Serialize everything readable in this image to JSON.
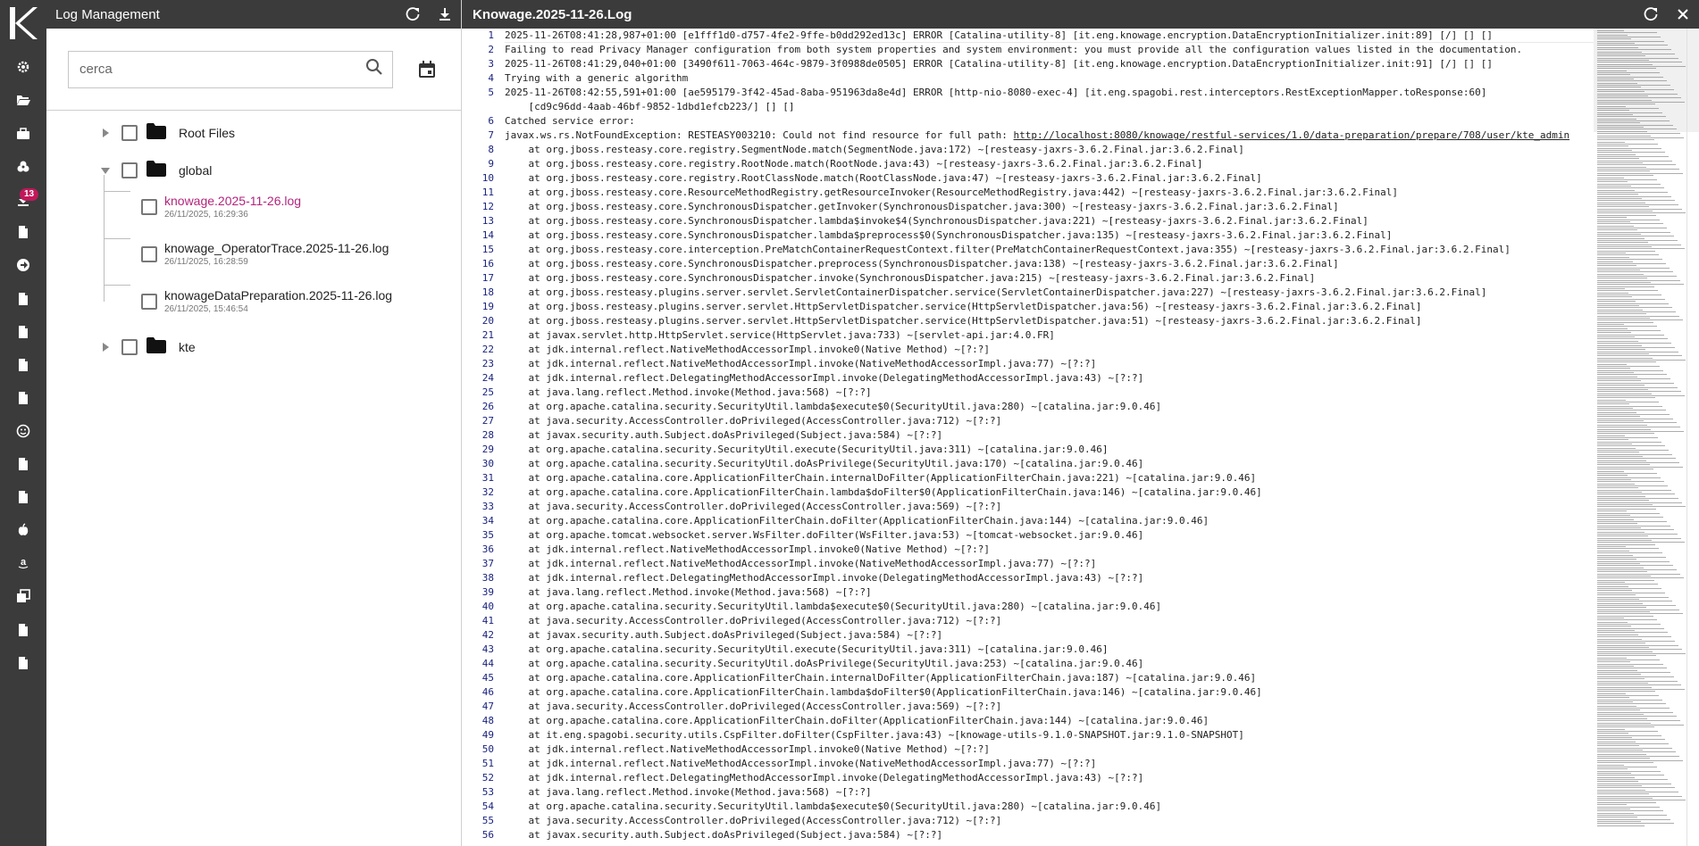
{
  "colors": {
    "rail_bg": "#3b3b3b",
    "active_file": "#b3247d",
    "badge": "#c2185b",
    "line_number": "#1a237e"
  },
  "rail": {
    "badge_count": "13",
    "items": [
      {
        "icon": "gear-icon"
      },
      {
        "icon": "folder-open-icon"
      },
      {
        "icon": "briefcase-icon"
      },
      {
        "icon": "cogs-icon"
      },
      {
        "icon": "download-icon"
      },
      {
        "icon": "document-icon"
      },
      {
        "icon": "arrow-circle-right-icon"
      },
      {
        "icon": "document-icon"
      },
      {
        "icon": "document-icon"
      },
      {
        "icon": "document-icon"
      },
      {
        "icon": "document-icon"
      },
      {
        "icon": "smile-icon"
      },
      {
        "icon": "document-icon"
      },
      {
        "icon": "document-icon"
      },
      {
        "icon": "apple-icon"
      },
      {
        "icon": "amazon-icon"
      },
      {
        "icon": "clone-icon"
      },
      {
        "icon": "document-icon"
      },
      {
        "icon": "document-icon"
      }
    ]
  },
  "panel": {
    "title": "Log Management",
    "refresh_icon": "refresh-icon",
    "download_icon": "download-icon",
    "search": {
      "placeholder": "cerca",
      "value": ""
    },
    "tree": {
      "root_files": "Root Files",
      "global": "global",
      "files": [
        {
          "name": "knowage.2025-11-26.log",
          "date": "26/11/2025, 16:29:36"
        },
        {
          "name": "knowage_OperatorTrace.2025-11-26.log",
          "date": "26/11/2025, 16:28:59"
        },
        {
          "name": "knowageDataPreparation.2025-11-26.log",
          "date": "26/11/2025, 15:46:54"
        }
      ],
      "kte": "kte"
    }
  },
  "viewer": {
    "title": "Knowage.2025-11-26.Log",
    "line_numbers": [
      "1",
      "2",
      "3",
      "4",
      "5",
      "",
      "6",
      "7",
      "8",
      "9",
      "10",
      "11",
      "12",
      "13",
      "14",
      "15",
      "16",
      "17",
      "18",
      "19",
      "20",
      "21",
      "22",
      "23",
      "24",
      "25",
      "26",
      "27",
      "28",
      "29",
      "30",
      "31",
      "32",
      "33",
      "34",
      "35",
      "36",
      "37",
      "38",
      "39",
      "40",
      "41",
      "42",
      "43",
      "44",
      "45",
      "46",
      "47",
      "48",
      "49",
      "50",
      "51",
      "52",
      "53",
      "54",
      "55",
      "56"
    ],
    "lines": [
      "2025-11-26T08:41:28,987+01:00 [e1fff1d0-d757-4fe2-9ffe-b0dd292ed13c] ERROR [Catalina-utility-8] [it.eng.knowage.encryption.DataEncryptionInitializer.init:89] [/] [] []",
      "Failing to read Privacy Manager configuration from both system properties and system environment: you must provide all the configuration values listed in the documentation.",
      "2025-11-26T08:41:29,040+01:00 [3490f611-7063-464c-9879-3f0988de0505] ERROR [Catalina-utility-8] [it.eng.knowage.encryption.DataEncryptionInitializer.init:91] [/] [] []",
      "Trying with a generic algorithm",
      "2025-11-26T08:42:55,591+01:00 [ae595179-3f42-45ad-8aba-951963da8e4d] ERROR [http-nio-8080-exec-4] [it.eng.spagobi.rest.interceptors.RestExceptionMapper.toResponse:60]",
      "    [cd9c96dd-4aab-46bf-9852-1dbd1efcb223/] [] []",
      "Catched service error:",
      "javax.ws.rs.NotFoundException: RESTEASY003210: Could not find resource for full path: ",
      "    at org.jboss.resteasy.core.registry.SegmentNode.match(SegmentNode.java:172) ~[resteasy-jaxrs-3.6.2.Final.jar:3.6.2.Final]",
      "    at org.jboss.resteasy.core.registry.RootNode.match(RootNode.java:43) ~[resteasy-jaxrs-3.6.2.Final.jar:3.6.2.Final]",
      "    at org.jboss.resteasy.core.registry.RootClassNode.match(RootClassNode.java:47) ~[resteasy-jaxrs-3.6.2.Final.jar:3.6.2.Final]",
      "    at org.jboss.resteasy.core.ResourceMethodRegistry.getResourceInvoker(ResourceMethodRegistry.java:442) ~[resteasy-jaxrs-3.6.2.Final.jar:3.6.2.Final]",
      "    at org.jboss.resteasy.core.SynchronousDispatcher.getInvoker(SynchronousDispatcher.java:300) ~[resteasy-jaxrs-3.6.2.Final.jar:3.6.2.Final]",
      "    at org.jboss.resteasy.core.SynchronousDispatcher.lambda$invoke$4(SynchronousDispatcher.java:221) ~[resteasy-jaxrs-3.6.2.Final.jar:3.6.2.Final]",
      "    at org.jboss.resteasy.core.SynchronousDispatcher.lambda$preprocess$0(SynchronousDispatcher.java:135) ~[resteasy-jaxrs-3.6.2.Final.jar:3.6.2.Final]",
      "    at org.jboss.resteasy.core.interception.PreMatchContainerRequestContext.filter(PreMatchContainerRequestContext.java:355) ~[resteasy-jaxrs-3.6.2.Final.jar:3.6.2.Final]",
      "    at org.jboss.resteasy.core.SynchronousDispatcher.preprocess(SynchronousDispatcher.java:138) ~[resteasy-jaxrs-3.6.2.Final.jar:3.6.2.Final]",
      "    at org.jboss.resteasy.core.SynchronousDispatcher.invoke(SynchronousDispatcher.java:215) ~[resteasy-jaxrs-3.6.2.Final.jar:3.6.2.Final]",
      "    at org.jboss.resteasy.plugins.server.servlet.ServletContainerDispatcher.service(ServletContainerDispatcher.java:227) ~[resteasy-jaxrs-3.6.2.Final.jar:3.6.2.Final]",
      "    at org.jboss.resteasy.plugins.server.servlet.HttpServletDispatcher.service(HttpServletDispatcher.java:56) ~[resteasy-jaxrs-3.6.2.Final.jar:3.6.2.Final]",
      "    at org.jboss.resteasy.plugins.server.servlet.HttpServletDispatcher.service(HttpServletDispatcher.java:51) ~[resteasy-jaxrs-3.6.2.Final.jar:3.6.2.Final]",
      "    at javax.servlet.http.HttpServlet.service(HttpServlet.java:733) ~[servlet-api.jar:4.0.FR]",
      "    at jdk.internal.reflect.NativeMethodAccessorImpl.invoke0(Native Method) ~[?:?]",
      "    at jdk.internal.reflect.NativeMethodAccessorImpl.invoke(NativeMethodAccessorImpl.java:77) ~[?:?]",
      "    at jdk.internal.reflect.DelegatingMethodAccessorImpl.invoke(DelegatingMethodAccessorImpl.java:43) ~[?:?]",
      "    at java.lang.reflect.Method.invoke(Method.java:568) ~[?:?]",
      "    at org.apache.catalina.security.SecurityUtil.lambda$execute$0(SecurityUtil.java:280) ~[catalina.jar:9.0.46]",
      "    at java.security.AccessController.doPrivileged(AccessController.java:712) ~[?:?]",
      "    at javax.security.auth.Subject.doAsPrivileged(Subject.java:584) ~[?:?]",
      "    at org.apache.catalina.security.SecurityUtil.execute(SecurityUtil.java:311) ~[catalina.jar:9.0.46]",
      "    at org.apache.catalina.security.SecurityUtil.doAsPrivilege(SecurityUtil.java:170) ~[catalina.jar:9.0.46]",
      "    at org.apache.catalina.core.ApplicationFilterChain.internalDoFilter(ApplicationFilterChain.java:221) ~[catalina.jar:9.0.46]",
      "    at org.apache.catalina.core.ApplicationFilterChain.lambda$doFilter$0(ApplicationFilterChain.java:146) ~[catalina.jar:9.0.46]",
      "    at java.security.AccessController.doPrivileged(AccessController.java:569) ~[?:?]",
      "    at org.apache.catalina.core.ApplicationFilterChain.doFilter(ApplicationFilterChain.java:144) ~[catalina.jar:9.0.46]",
      "    at org.apache.tomcat.websocket.server.WsFilter.doFilter(WsFilter.java:53) ~[tomcat-websocket.jar:9.0.46]",
      "    at jdk.internal.reflect.NativeMethodAccessorImpl.invoke0(Native Method) ~[?:?]",
      "    at jdk.internal.reflect.NativeMethodAccessorImpl.invoke(NativeMethodAccessorImpl.java:77) ~[?:?]",
      "    at jdk.internal.reflect.DelegatingMethodAccessorImpl.invoke(DelegatingMethodAccessorImpl.java:43) ~[?:?]",
      "    at java.lang.reflect.Method.invoke(Method.java:568) ~[?:?]",
      "    at org.apache.catalina.security.SecurityUtil.lambda$execute$0(SecurityUtil.java:280) ~[catalina.jar:9.0.46]",
      "    at java.security.AccessController.doPrivileged(AccessController.java:712) ~[?:?]",
      "    at javax.security.auth.Subject.doAsPrivileged(Subject.java:584) ~[?:?]",
      "    at org.apache.catalina.security.SecurityUtil.execute(SecurityUtil.java:311) ~[catalina.jar:9.0.46]",
      "    at org.apache.catalina.security.SecurityUtil.doAsPrivilege(SecurityUtil.java:253) ~[catalina.jar:9.0.46]",
      "    at org.apache.catalina.core.ApplicationFilterChain.internalDoFilter(ApplicationFilterChain.java:187) ~[catalina.jar:9.0.46]",
      "    at org.apache.catalina.core.ApplicationFilterChain.lambda$doFilter$0(ApplicationFilterChain.java:146) ~[catalina.jar:9.0.46]",
      "    at java.security.AccessController.doPrivileged(AccessController.java:569) ~[?:?]",
      "    at org.apache.catalina.core.ApplicationFilterChain.doFilter(ApplicationFilterChain.java:144) ~[catalina.jar:9.0.46]",
      "    at it.eng.spagobi.security.utils.CspFilter.doFilter(CspFilter.java:43) ~[knowage-utils-9.1.0-SNAPSHOT.jar:9.1.0-SNAPSHOT]",
      "    at jdk.internal.reflect.NativeMethodAccessorImpl.invoke0(Native Method) ~[?:?]",
      "    at jdk.internal.reflect.NativeMethodAccessorImpl.invoke(NativeMethodAccessorImpl.java:77) ~[?:?]",
      "    at jdk.internal.reflect.DelegatingMethodAccessorImpl.invoke(DelegatingMethodAccessorImpl.java:43) ~[?:?]",
      "    at java.lang.reflect.Method.invoke(Method.java:568) ~[?:?]",
      "    at org.apache.catalina.security.SecurityUtil.lambda$execute$0(SecurityUtil.java:280) ~[catalina.jar:9.0.46]",
      "    at java.security.AccessController.doPrivileged(AccessController.java:712) ~[?:?]",
      "    at javax.security.auth.Subject.doAsPrivileged(Subject.java:584) ~[?:?]"
    ],
    "link_text": "http://localhost:8080/knowage/restful-services/1.0/data-preparation/prepare/708/user/kte_admin"
  }
}
